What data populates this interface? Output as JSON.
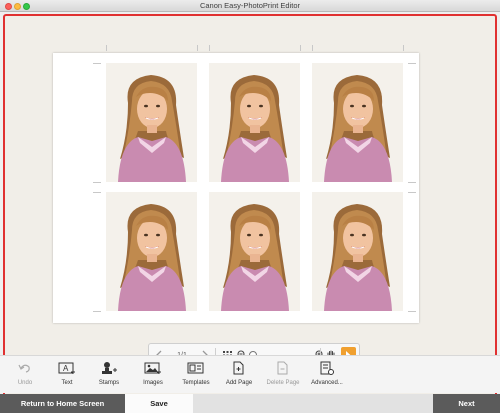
{
  "window": {
    "title": "Canon Easy-PhotoPrint Editor"
  },
  "navigation": {
    "page_indicator": "1/1"
  },
  "toolbar": {
    "items": [
      {
        "label": "Undo",
        "icon": "undo-icon",
        "enabled": false
      },
      {
        "label": "Text",
        "icon": "text-icon",
        "enabled": true
      },
      {
        "label": "Stamps",
        "icon": "stamps-icon",
        "enabled": true
      },
      {
        "label": "Images",
        "icon": "images-icon",
        "enabled": true
      },
      {
        "label": "Templates",
        "icon": "templates-icon",
        "enabled": true
      },
      {
        "label": "Add Page",
        "icon": "add-page-icon",
        "enabled": true
      },
      {
        "label": "Delete Page",
        "icon": "delete-page-icon",
        "enabled": false
      },
      {
        "label": "Advanced...",
        "icon": "advanced-icon",
        "enabled": true
      }
    ]
  },
  "footer": {
    "home_label": "Return to Home Screen",
    "save_label": "Save",
    "next_label": "Next"
  },
  "colors": {
    "selection_border": "#e03131",
    "select_tool_accent": "#f0a030",
    "dark_button": "#5b5b5b",
    "photo_background": "#f4f1eb"
  }
}
